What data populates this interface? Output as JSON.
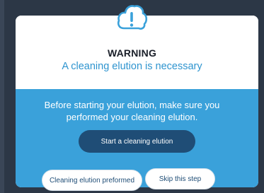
{
  "dialog": {
    "icon": "cloud-warning-icon",
    "title": "WARNING",
    "subtitle": "A cleaning elution is necessary",
    "message": "Before starting your elution, make sure you performed your cleaning elution.",
    "buttons": {
      "start": "Start a cleaning elution",
      "preformed": "Cleaning elution preformed",
      "skip": "Skip this step"
    }
  },
  "colors": {
    "backdrop": "#2c3746",
    "body": "#3aa1da",
    "primary_button": "#1f4d76",
    "subtitle": "#2e94cf"
  }
}
